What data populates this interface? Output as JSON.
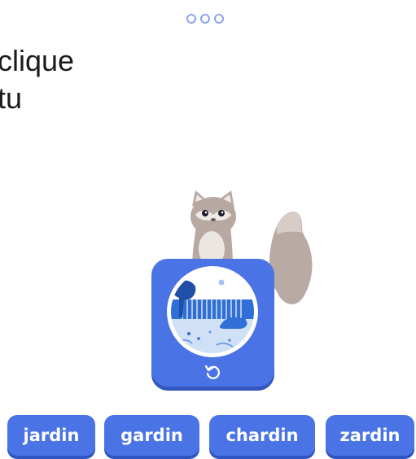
{
  "progress": {
    "total": 3,
    "completed": 0
  },
  "instruction": {
    "line1": "clique",
    "line2": "tu"
  },
  "audio_card": {
    "icon": "replay-icon"
  },
  "options": [
    {
      "label": "jardin"
    },
    {
      "label": "gardin"
    },
    {
      "label": "chardin"
    },
    {
      "label": "zardin"
    }
  ],
  "colors": {
    "accent": "#4a73e5",
    "accent_shadow": "#2f55c2",
    "progress_dot": "#8ea2ee",
    "text": "#1b1b1b"
  }
}
